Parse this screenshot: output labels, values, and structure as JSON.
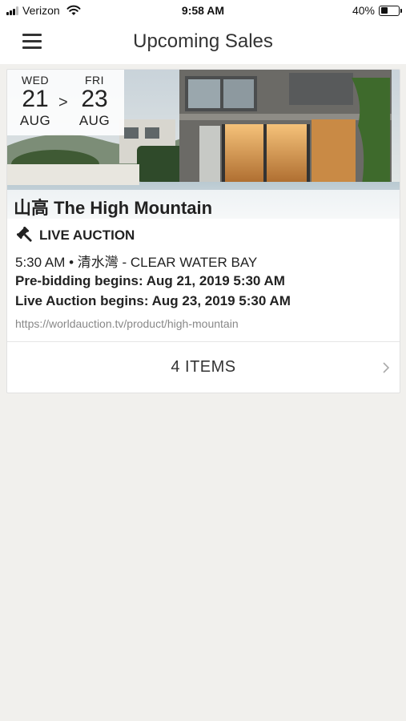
{
  "status_bar": {
    "carrier": "Verizon",
    "time": "9:58 AM",
    "battery_percent": "40%",
    "battery_level": 0.4
  },
  "nav": {
    "title": "Upcoming Sales",
    "menu_icon": "hamburger-menu-icon"
  },
  "sale": {
    "start": {
      "dow": "WED",
      "day": "21",
      "month": "AUG"
    },
    "separator": ">",
    "end": {
      "dow": "FRI",
      "day": "23",
      "month": "AUG"
    },
    "title": "山高 The High Mountain",
    "auction_type": "LIVE AUCTION",
    "auction_icon": "gavel-icon",
    "time_location": "5:30 AM • 清水灣 - CLEAR WATER BAY",
    "pre_bidding": "Pre-bidding begins: Aug 21, 2019 5:30 AM",
    "live_auction": "Live Auction begins: Aug 23, 2019 5:30 AM",
    "url": "https://worldauction.tv/product/high-mountain",
    "items_label": "4 ITEMS"
  }
}
